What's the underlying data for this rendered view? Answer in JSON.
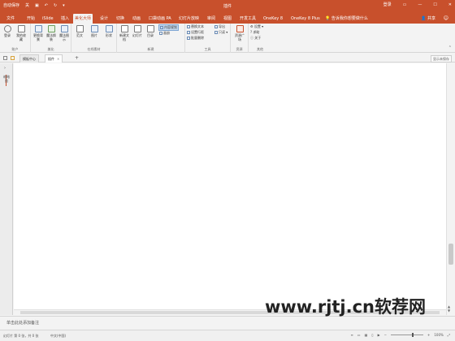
{
  "titlebar": {
    "autosave": "自动保存",
    "autosave_state": "关",
    "title": "插件",
    "login": "登录",
    "colors": {
      "brand": "#c8502c"
    }
  },
  "tabs": [
    {
      "label": "文件"
    },
    {
      "label": "开始"
    },
    {
      "label": "iSlide"
    },
    {
      "label": "插入"
    },
    {
      "label": "美化大师"
    },
    {
      "label": "设计"
    },
    {
      "label": "切换"
    },
    {
      "label": "动画"
    },
    {
      "label": "口袋动画 PA"
    },
    {
      "label": "幻灯片放映"
    },
    {
      "label": "审阅"
    },
    {
      "label": "视图"
    },
    {
      "label": "开发工具"
    },
    {
      "label": "OneKey 8"
    },
    {
      "label": "OneKey 8 Plus"
    }
  ],
  "tell_me": "告诉我你想要做什么",
  "share": "共享",
  "ribbon": {
    "groups": {
      "account": {
        "label": "账户",
        "buttons": [
          "登录",
          "我的收藏"
        ]
      },
      "beautify": {
        "label": "美化",
        "buttons": [
          "更换背景",
          "魔法换装",
          "魔法图示"
        ]
      },
      "online": {
        "label": "在线素材",
        "buttons": [
          "范文",
          "图片",
          "形状"
        ]
      },
      "new": {
        "label": "新建",
        "buttons": [
          "新建文档",
          "幻灯片",
          "目录"
        ],
        "smalls": [
          "内容规划",
          "画册"
        ]
      },
      "tools": {
        "label": "工具",
        "smalls": [
          "替换文本",
          "导出",
          "设置行距",
          "只读",
          "批量删除"
        ]
      },
      "resources": {
        "label": "资源",
        "buttons": [
          "资源广场"
        ]
      },
      "other": {
        "label": "其他",
        "smalls": [
          "设置",
          "求助",
          "关于"
        ]
      }
    }
  },
  "docbar": {
    "tabs": [
      {
        "label": "模板中心"
      },
      {
        "label": "插件"
      }
    ],
    "right_button": "显示未保存"
  },
  "outline_label": "缩略图",
  "notes_placeholder": "单击此处添加备注",
  "status": {
    "slide_info": "幻灯片 第 0 张，共 0 张",
    "language": "中文(中国)",
    "zoom": "100%"
  },
  "watermark": "www.rjtj.cn软荐网"
}
